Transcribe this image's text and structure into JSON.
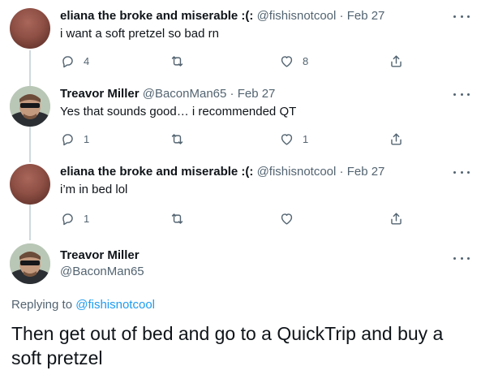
{
  "tweets": [
    {
      "name": "eliana the broke and miserable :(:",
      "handle": "@fishisnotcool",
      "date": "Feb 27",
      "text": "i want a soft pretzel so bad rn",
      "replies": "4",
      "retweets": "",
      "likes": "8"
    },
    {
      "name": "Treavor Miller",
      "handle": "@BaconMan65",
      "date": "Feb 27",
      "text": "Yes that sounds good… i recommended QT",
      "replies": "1",
      "retweets": "",
      "likes": "1"
    },
    {
      "name": "eliana the broke and miserable :(:",
      "handle": "@fishisnotcool",
      "date": "Feb 27",
      "text": "i’m in bed lol",
      "replies": "1",
      "retweets": "",
      "likes": ""
    }
  ],
  "main_tweet": {
    "name": "Treavor Miller",
    "handle": "@BaconMan65",
    "replying_prefix": "Replying to",
    "replying_to": "@fishisnotcool",
    "text": "Then get out of bed and go to a QuickTrip and buy a soft pretzel"
  },
  "icons": {
    "reply": "reply-icon",
    "retweet": "retweet-icon",
    "like": "heart-icon",
    "share": "share-icon",
    "more": "more-icon"
  },
  "colors": {
    "text": "#0f1419",
    "secondary": "#536471",
    "link": "#1d9bf0",
    "thread_line": "#cfd9de"
  }
}
